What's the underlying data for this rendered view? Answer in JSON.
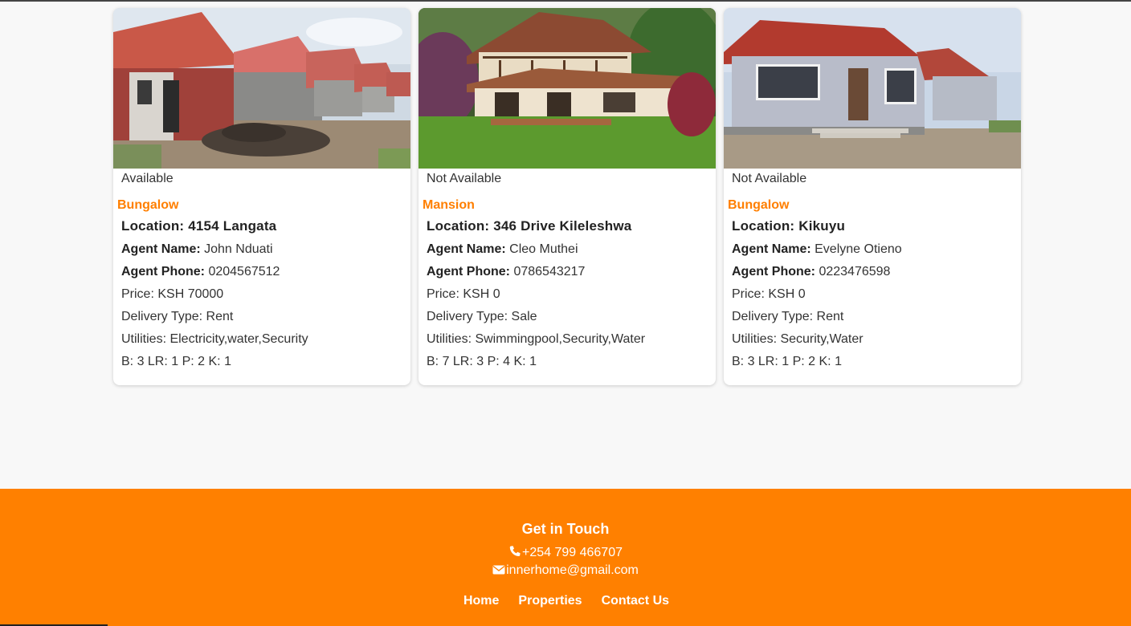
{
  "listings": [
    {
      "status": "Available",
      "type": "Bungalow",
      "location": "Location: 4154 Langata",
      "agent_name_label": "Agent Name:",
      "agent_name": " John Nduati",
      "agent_phone_label": "Agent Phone:",
      "agent_phone": " 0204567512",
      "price": "Price: KSH 70000",
      "delivery": "Delivery Type: Rent",
      "utilities": "Utilities: Electricity,water,Security",
      "rooms": "B: 3 LR: 1 P: 2 K: 1"
    },
    {
      "status": "Not Available",
      "type": "Mansion",
      "location": "Location: 346 Drive Kileleshwa",
      "agent_name_label": "Agent Name:",
      "agent_name": " Cleo Muthei",
      "agent_phone_label": "Agent Phone:",
      "agent_phone": " 0786543217",
      "price": "Price: KSH 0",
      "delivery": "Delivery Type: Sale",
      "utilities": "Utilities: Swimmingpool,Security,Water",
      "rooms": "B: 7 LR: 3 P: 4 K: 1"
    },
    {
      "status": "Not Available",
      "type": "Bungalow",
      "location": "Location: Kikuyu",
      "agent_name_label": "Agent Name:",
      "agent_name": " Evelyne Otieno",
      "agent_phone_label": "Agent Phone:",
      "agent_phone": " 0223476598",
      "price": "Price: KSH 0",
      "delivery": "Delivery Type: Rent",
      "utilities": "Utilities: Security,Water",
      "rooms": "B: 3 LR: 1 P: 2 K: 1"
    }
  ],
  "footer": {
    "title": "Get in Touch",
    "phone": "+254 799 466707",
    "email": "innerhome@gmail.com",
    "nav": [
      "Home",
      "Properties",
      "Contact Us"
    ]
  },
  "colors": {
    "accent": "#ff8000",
    "page_bg": "#f8f8f8"
  },
  "icons": {
    "phone": "phone-icon",
    "email": "envelope-icon"
  }
}
